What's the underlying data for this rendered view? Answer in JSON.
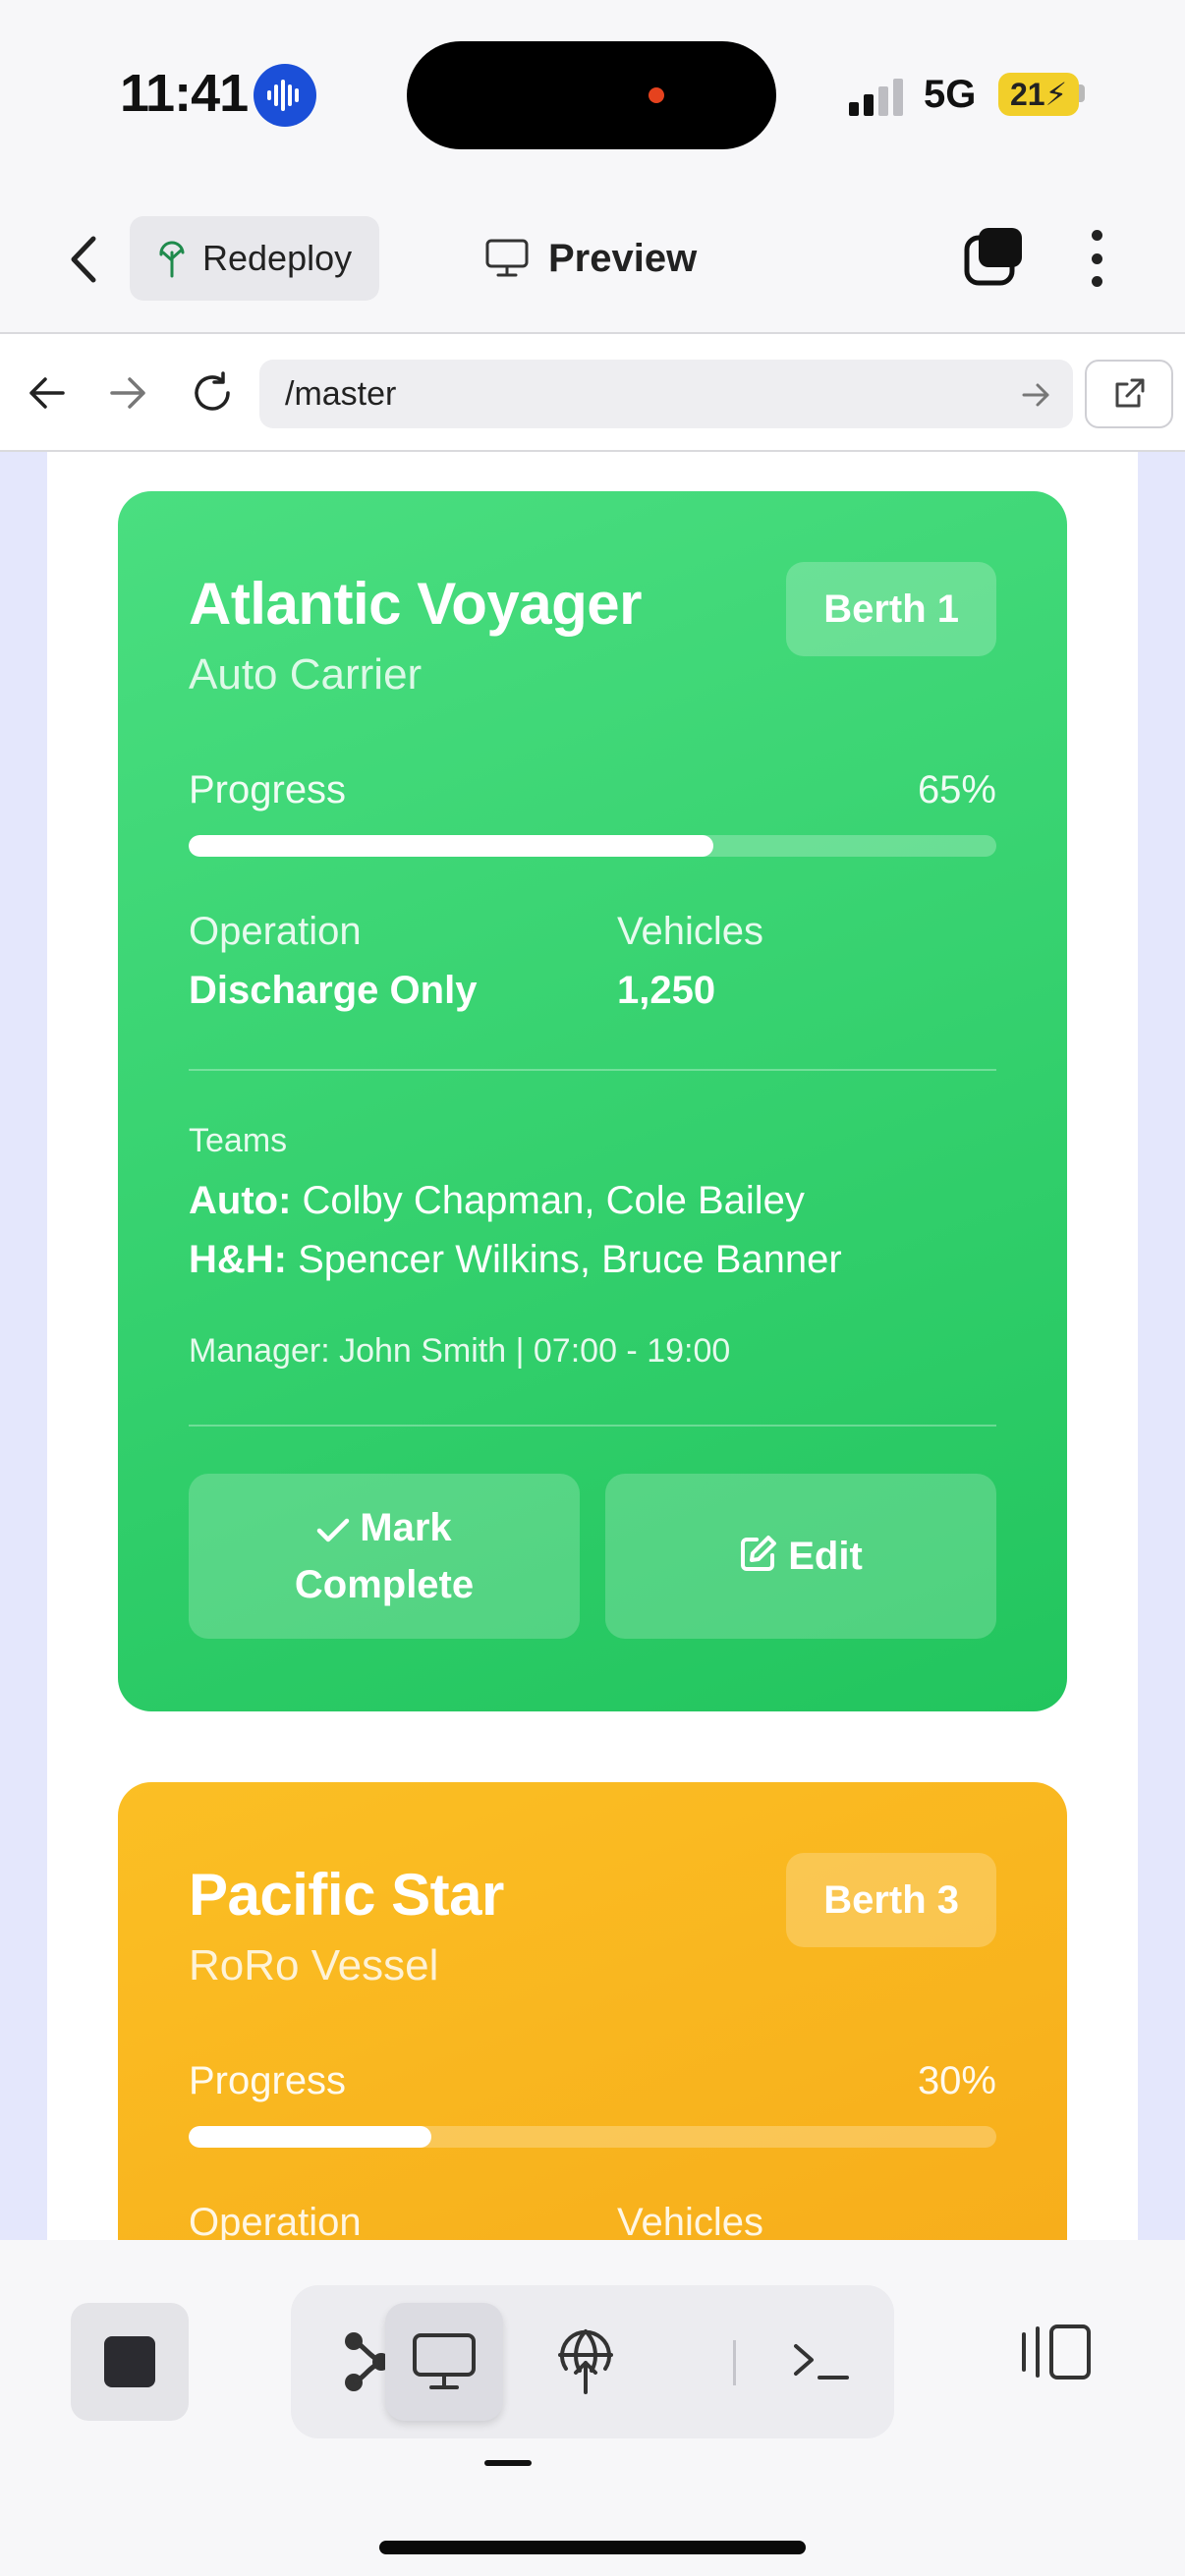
{
  "status_bar": {
    "time": "11:41",
    "network": "5G",
    "battery": "21"
  },
  "nav": {
    "redeploy_label": "Redeploy",
    "preview_label": "Preview"
  },
  "url_bar": {
    "url": "/master"
  },
  "cards": [
    {
      "name": "Atlantic Voyager",
      "type": "Auto Carrier",
      "berth": "Berth 1",
      "progress_label": "Progress",
      "progress_text": "65%",
      "progress_value": 0.65,
      "operation_label": "Operation",
      "operation": "Discharge Only",
      "vehicles_label": "Vehicles",
      "vehicles": "1,250",
      "teams_label": "Teams",
      "team_auto_label": "Auto:",
      "team_auto": "Colby Chapman, Cole Bailey",
      "team_hh_label": "H&H:",
      "team_hh": "Spencer Wilkins, Bruce Banner",
      "manager": "Manager: John Smith | 07:00 - 19:00",
      "mark_complete_line1": "Mark",
      "mark_complete_line2": "Complete",
      "edit_label": "Edit",
      "color": "#22c55e"
    },
    {
      "name": "Pacific Star",
      "type": "RoRo Vessel",
      "berth": "Berth 3",
      "progress_label": "Progress",
      "progress_text": "30%",
      "progress_value": 0.3,
      "operation_label": "Operation",
      "vehicles_label": "Vehicles",
      "color": "#f5a516"
    }
  ]
}
